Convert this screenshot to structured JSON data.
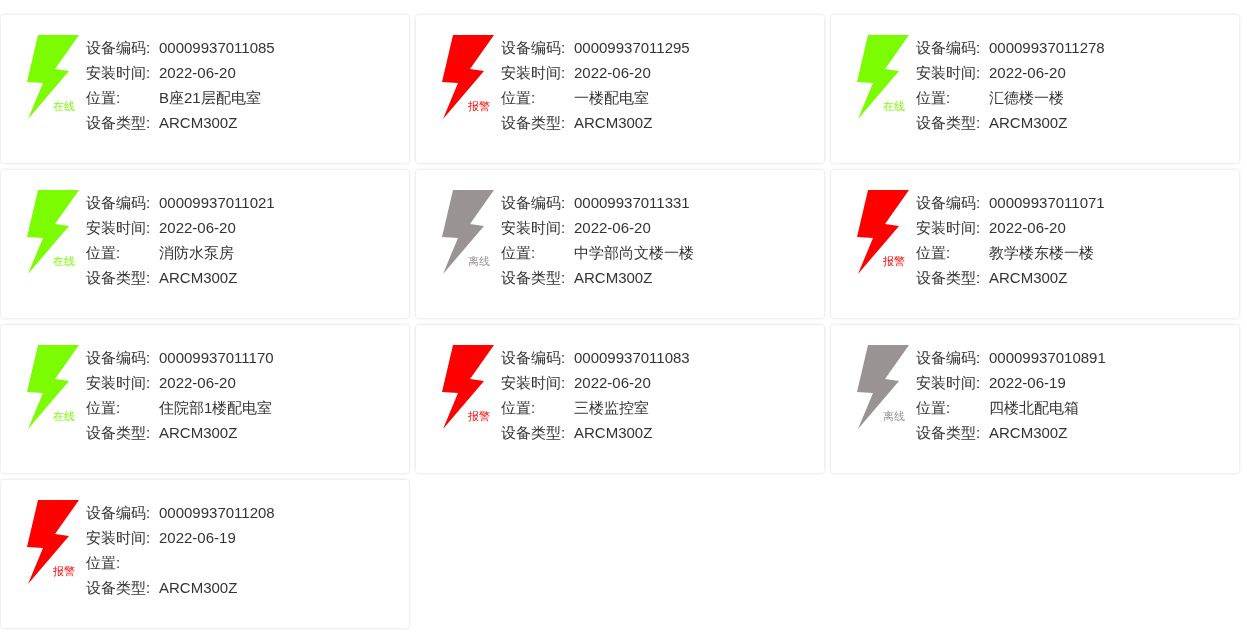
{
  "devices": [
    {
      "status": {
        "kind": "online",
        "label": "在线"
      },
      "fields": [
        {
          "label": "设备编码:",
          "value": "00009937011085"
        },
        {
          "label": "安装时间:",
          "value": "2022-06-20"
        },
        {
          "label": "位置:",
          "value": "B座21层配电室"
        },
        {
          "label": "设备类型:",
          "value": "ARCM300Z"
        }
      ]
    },
    {
      "status": {
        "kind": "alarm",
        "label": "报警"
      },
      "fields": [
        {
          "label": "设备编码:",
          "value": "00009937011295"
        },
        {
          "label": "安装时间:",
          "value": "2022-06-20"
        },
        {
          "label": "位置:",
          "value": "一楼配电室"
        },
        {
          "label": "设备类型:",
          "value": "ARCM300Z"
        }
      ]
    },
    {
      "status": {
        "kind": "online",
        "label": "在线"
      },
      "fields": [
        {
          "label": "设备编码:",
          "value": "00009937011278"
        },
        {
          "label": "安装时间:",
          "value": "2022-06-20"
        },
        {
          "label": "位置:",
          "value": "汇德楼一楼"
        },
        {
          "label": "设备类型:",
          "value": "ARCM300Z"
        }
      ]
    },
    {
      "status": {
        "kind": "online",
        "label": "在线"
      },
      "fields": [
        {
          "label": "设备编码:",
          "value": "00009937011021"
        },
        {
          "label": "安装时间:",
          "value": "2022-06-20"
        },
        {
          "label": "位置:",
          "value": "消防水泵房"
        },
        {
          "label": "设备类型:",
          "value": "ARCM300Z"
        }
      ]
    },
    {
      "status": {
        "kind": "offline",
        "label": "离线"
      },
      "fields": [
        {
          "label": "设备编码:",
          "value": "00009937011331"
        },
        {
          "label": "安装时间:",
          "value": "2022-06-20"
        },
        {
          "label": "位置:",
          "value": "中学部尚文楼一楼"
        },
        {
          "label": "设备类型:",
          "value": "ARCM300Z"
        }
      ]
    },
    {
      "status": {
        "kind": "alarm",
        "label": "报警"
      },
      "fields": [
        {
          "label": "设备编码:",
          "value": "00009937011071"
        },
        {
          "label": "安装时间:",
          "value": "2022-06-20"
        },
        {
          "label": "位置:",
          "value": "教学楼东楼一楼"
        },
        {
          "label": "设备类型:",
          "value": "ARCM300Z"
        }
      ]
    },
    {
      "status": {
        "kind": "online",
        "label": "在线"
      },
      "fields": [
        {
          "label": "设备编码:",
          "value": "00009937011170"
        },
        {
          "label": "安装时间:",
          "value": "2022-06-20"
        },
        {
          "label": "位置:",
          "value": "住院部1楼配电室"
        },
        {
          "label": "设备类型:",
          "value": "ARCM300Z"
        }
      ]
    },
    {
      "status": {
        "kind": "alarm",
        "label": "报警"
      },
      "fields": [
        {
          "label": "设备编码:",
          "value": "00009937011083"
        },
        {
          "label": "安装时间:",
          "value": "2022-06-20"
        },
        {
          "label": "位置:",
          "value": "三楼监控室"
        },
        {
          "label": "设备类型:",
          "value": "ARCM300Z"
        }
      ]
    },
    {
      "status": {
        "kind": "offline",
        "label": "离线"
      },
      "fields": [
        {
          "label": "设备编码:",
          "value": "00009937010891"
        },
        {
          "label": "安装时间:",
          "value": "2022-06-19"
        },
        {
          "label": "位置:",
          "value": "四楼北配电箱"
        },
        {
          "label": "设备类型:",
          "value": "ARCM300Z"
        }
      ]
    },
    {
      "status": {
        "kind": "alarm",
        "label": "报警"
      },
      "fields": [
        {
          "label": "设备编码:",
          "value": "00009937011208"
        },
        {
          "label": "安装时间:",
          "value": "2022-06-19"
        },
        {
          "label": "位置:"
        },
        {
          "label": "设备类型:",
          "value": "ARCM300Z"
        }
      ]
    }
  ]
}
